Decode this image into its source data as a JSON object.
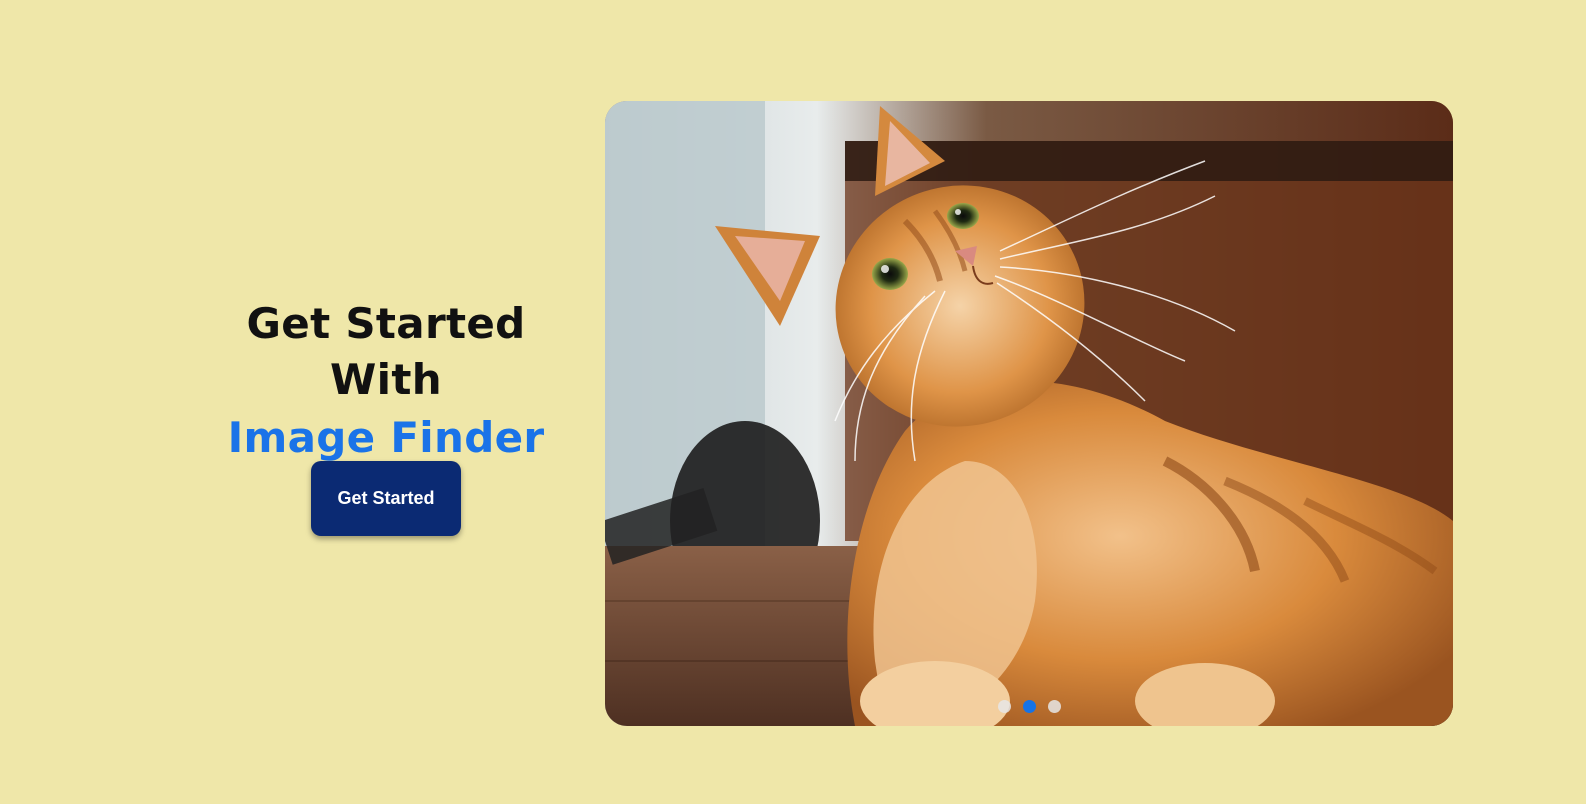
{
  "hero": {
    "headline_line1": "Get Started With",
    "headline_line2": "Image Finder",
    "cta_label": "Get Started"
  },
  "carousel": {
    "slide_subject": "orange-tabby-cat-photo",
    "slide_count": 3,
    "active_slide": 2
  },
  "colors": {
    "background": "#EFE7A9",
    "accent": "#1A73E8",
    "button": "#0B2A73"
  }
}
